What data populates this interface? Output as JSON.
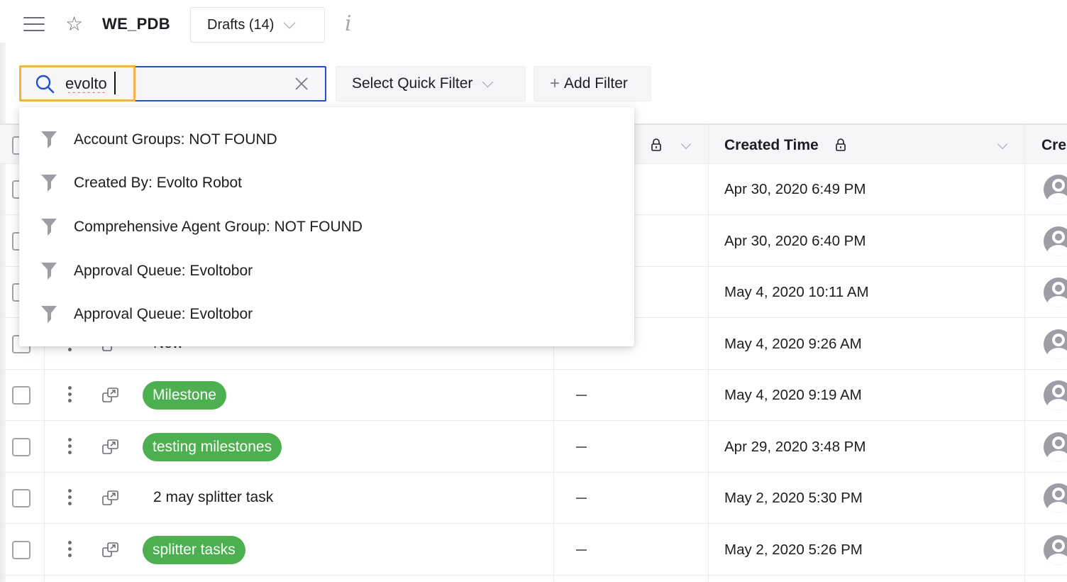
{
  "header": {
    "title": "WE_PDB",
    "view_selector": "Drafts (14)",
    "menu_icon": "hamburger-icon",
    "favorite_icon": "star-icon",
    "info_icon": "info-icon"
  },
  "filters": {
    "search_value": "evolto",
    "quick_filter_label": "Select Quick Filter",
    "add_filter_label": "Add Filter",
    "add_filter_prefix": "+"
  },
  "suggestions": [
    {
      "label": "Account Groups: NOT FOUND"
    },
    {
      "label": "Created By: Evolto Robot"
    },
    {
      "label": "Comprehensive Agent Group: NOT FOUND"
    },
    {
      "label": "Approval Queue: Evoltobor"
    },
    {
      "label": "Approval Queue: Evoltobor"
    }
  ],
  "table": {
    "columns": {
      "created_time": "Created Time",
      "created_by_partial": "Cre"
    },
    "rows": [
      {
        "name": "",
        "style": "hidden",
        "field": "",
        "created_time": "Apr 30, 2020 6:49 PM"
      },
      {
        "name": "",
        "style": "hidden",
        "field": "",
        "created_time": "Apr 30, 2020 6:40 PM"
      },
      {
        "name": "",
        "style": "hidden",
        "field": "",
        "created_time": "May 4, 2020 10:11 AM"
      },
      {
        "name": "New",
        "style": "plain",
        "field": "",
        "created_time": "May 4, 2020 9:26 AM"
      },
      {
        "name": "Milestone",
        "style": "pill",
        "field": "–",
        "created_time": "May 4, 2020 9:19 AM"
      },
      {
        "name": "testing milestones",
        "style": "pill",
        "field": "–",
        "created_time": "Apr 29, 2020 3:48 PM"
      },
      {
        "name": "2 may splitter task",
        "style": "plain",
        "field": "–",
        "created_time": "May 2, 2020 5:30 PM"
      },
      {
        "name": "splitter tasks",
        "style": "pill",
        "field": "–",
        "created_time": "May 2, 2020 5:26 PM"
      }
    ]
  },
  "colors": {
    "accent_blue": "#2450cc",
    "highlight_orange": "#f2b24a",
    "pill_green": "#4caf50",
    "icon_gray": "#9d9da5"
  }
}
